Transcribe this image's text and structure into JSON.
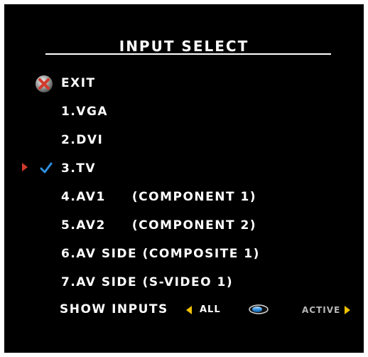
{
  "menu": {
    "title": "INPUT SELECT",
    "exit_label": "EXIT",
    "items": [
      {
        "label": "1.VGA"
      },
      {
        "label": "2.DVI"
      },
      {
        "label": "3.TV"
      },
      {
        "label": "4.AV1     (COMPONENT 1)"
      },
      {
        "label": "5.AV2     (COMPONENT 2)"
      },
      {
        "label": "6.AV SIDE (COMPOSITE 1)"
      },
      {
        "label": "7.AV SIDE (S-VIDEO 1)"
      }
    ],
    "selected_index": 2
  },
  "show_inputs": {
    "label": "SHOW INPUTS",
    "left_option": "ALL",
    "right_option": "ACTIVE"
  },
  "colors": {
    "background": "#000000",
    "text": "#ffffff",
    "arrow_yellow": "#f2c200",
    "pointer_red": "#d23a2a",
    "check_blue": "#2f8fe0",
    "inactive_text": "#b8b8b8"
  },
  "icons": {
    "exit": "exit-x-icon",
    "selection_pointer": "pointer-triangle-icon",
    "selected": "checkmark-icon",
    "left": "triangle-left-icon",
    "right": "triangle-right-icon",
    "remote_button": "remote-button-icon"
  }
}
